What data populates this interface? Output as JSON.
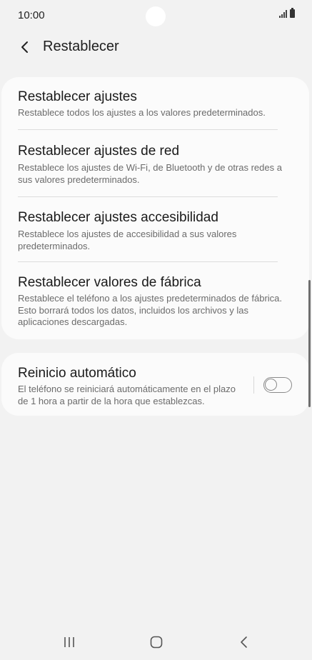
{
  "status_bar": {
    "time": "10:00"
  },
  "header": {
    "title": "Restablecer"
  },
  "reset_items": [
    {
      "title": "Restablecer ajustes",
      "description": "Restablece todos los ajustes a los valores predeterminados."
    },
    {
      "title": "Restablecer ajustes de red",
      "description": "Restablece los ajustes de Wi-Fi, de Bluetooth y de otras redes a sus valores predeterminados."
    },
    {
      "title": "Restablecer ajustes accesibilidad",
      "description": "Restablece los ajustes de accesibilidad a sus valores predeterminados."
    },
    {
      "title": "Restablecer valores de fábrica",
      "description": "Restablece el teléfono a los ajustes predeterminados de fábrica. Esto borrará todos los datos, incluidos los archivos y las aplicaciones descargadas."
    }
  ],
  "auto_restart": {
    "title": "Reinicio automático",
    "description": "El teléfono se reiniciará automáticamente en el plazo de 1 hora a partir de la hora que establezcas.",
    "enabled": false
  },
  "icons": {
    "back": "chevron-left-icon",
    "signal": "signal-icon",
    "battery": "battery-icon",
    "recent_apps": "recent-apps-icon",
    "home": "home-icon",
    "nav_back": "back-arrow-icon"
  }
}
